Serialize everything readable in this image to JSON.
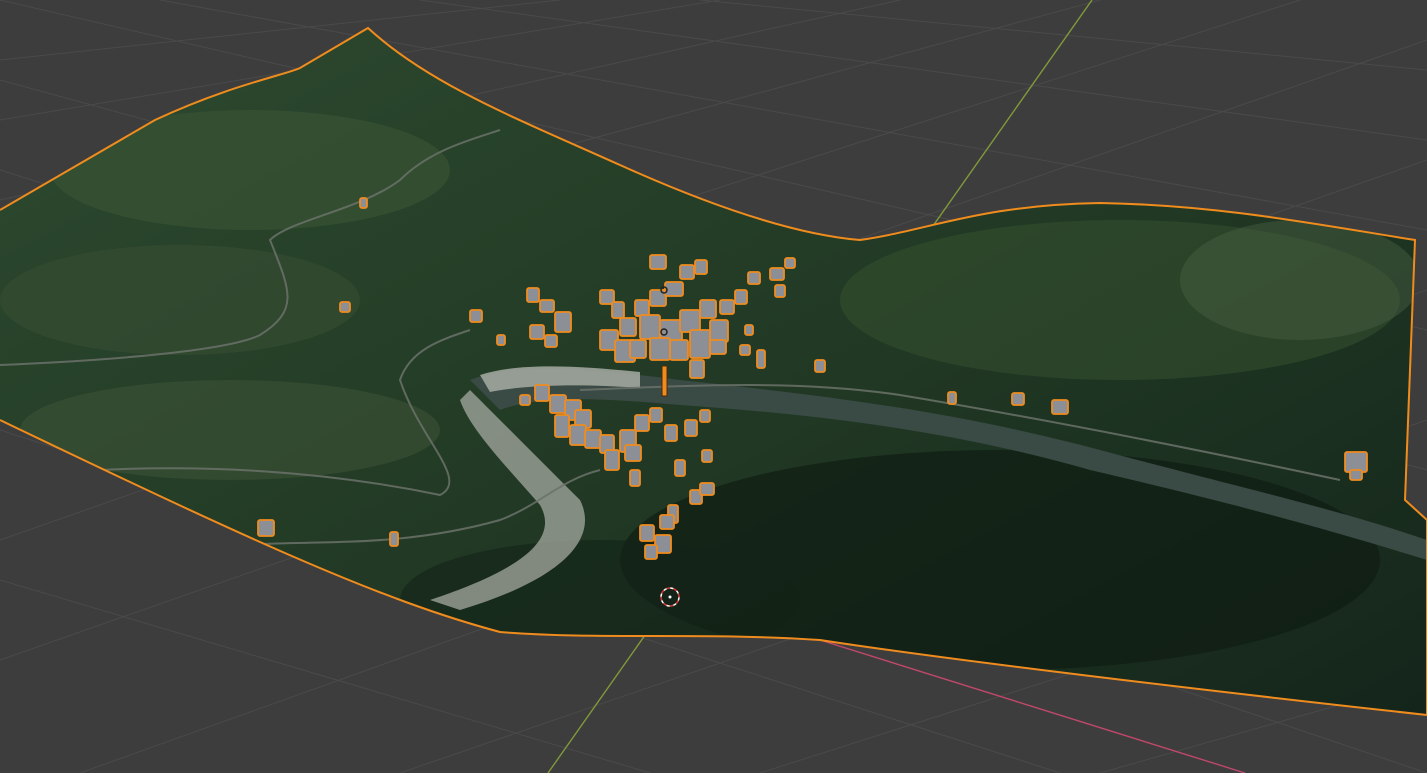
{
  "app": "3D viewport",
  "viewport": {
    "background_color": "#3d3d3d",
    "grid_color": "#4a4a4a",
    "axis_x_color": "#c0486a",
    "axis_y_color": "#7f9a3a",
    "selection_color": "#f08c1e",
    "building_color": "#8c8f96",
    "terrain_dark": "#17291a",
    "terrain_mid": "#2d4a2f",
    "river_color": "#3a4a44",
    "gravel_color": "#9ea39a"
  },
  "scene": {
    "selected_object": "terrain-mesh",
    "objects_selected": true,
    "cursor_icon": "3d-cursor-icon",
    "origin_icon": "object-origin-icon"
  }
}
